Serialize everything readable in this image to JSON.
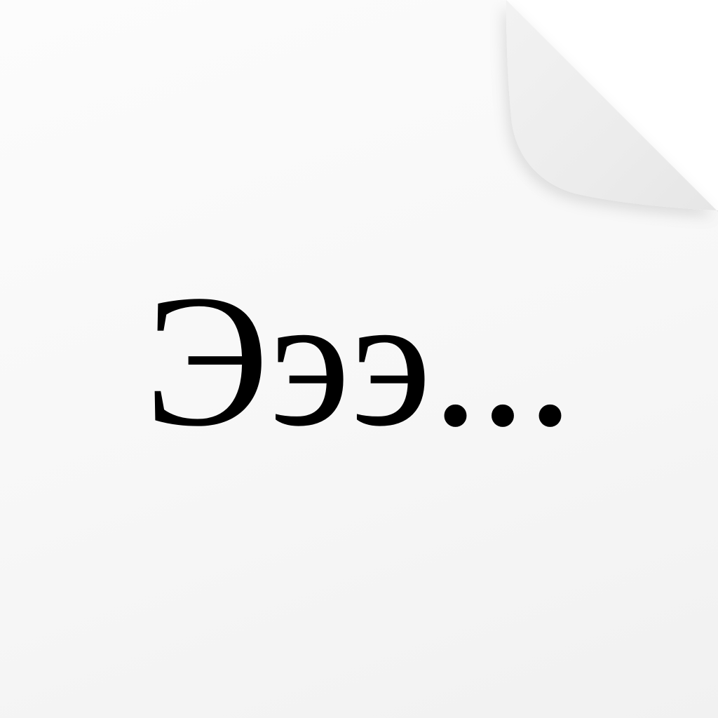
{
  "document": {
    "text": "Эээ..."
  },
  "icon": "document-page-curl-icon",
  "colors": {
    "page": "#f7f7f7",
    "curl": "#eeeeee",
    "text": "#000000"
  }
}
